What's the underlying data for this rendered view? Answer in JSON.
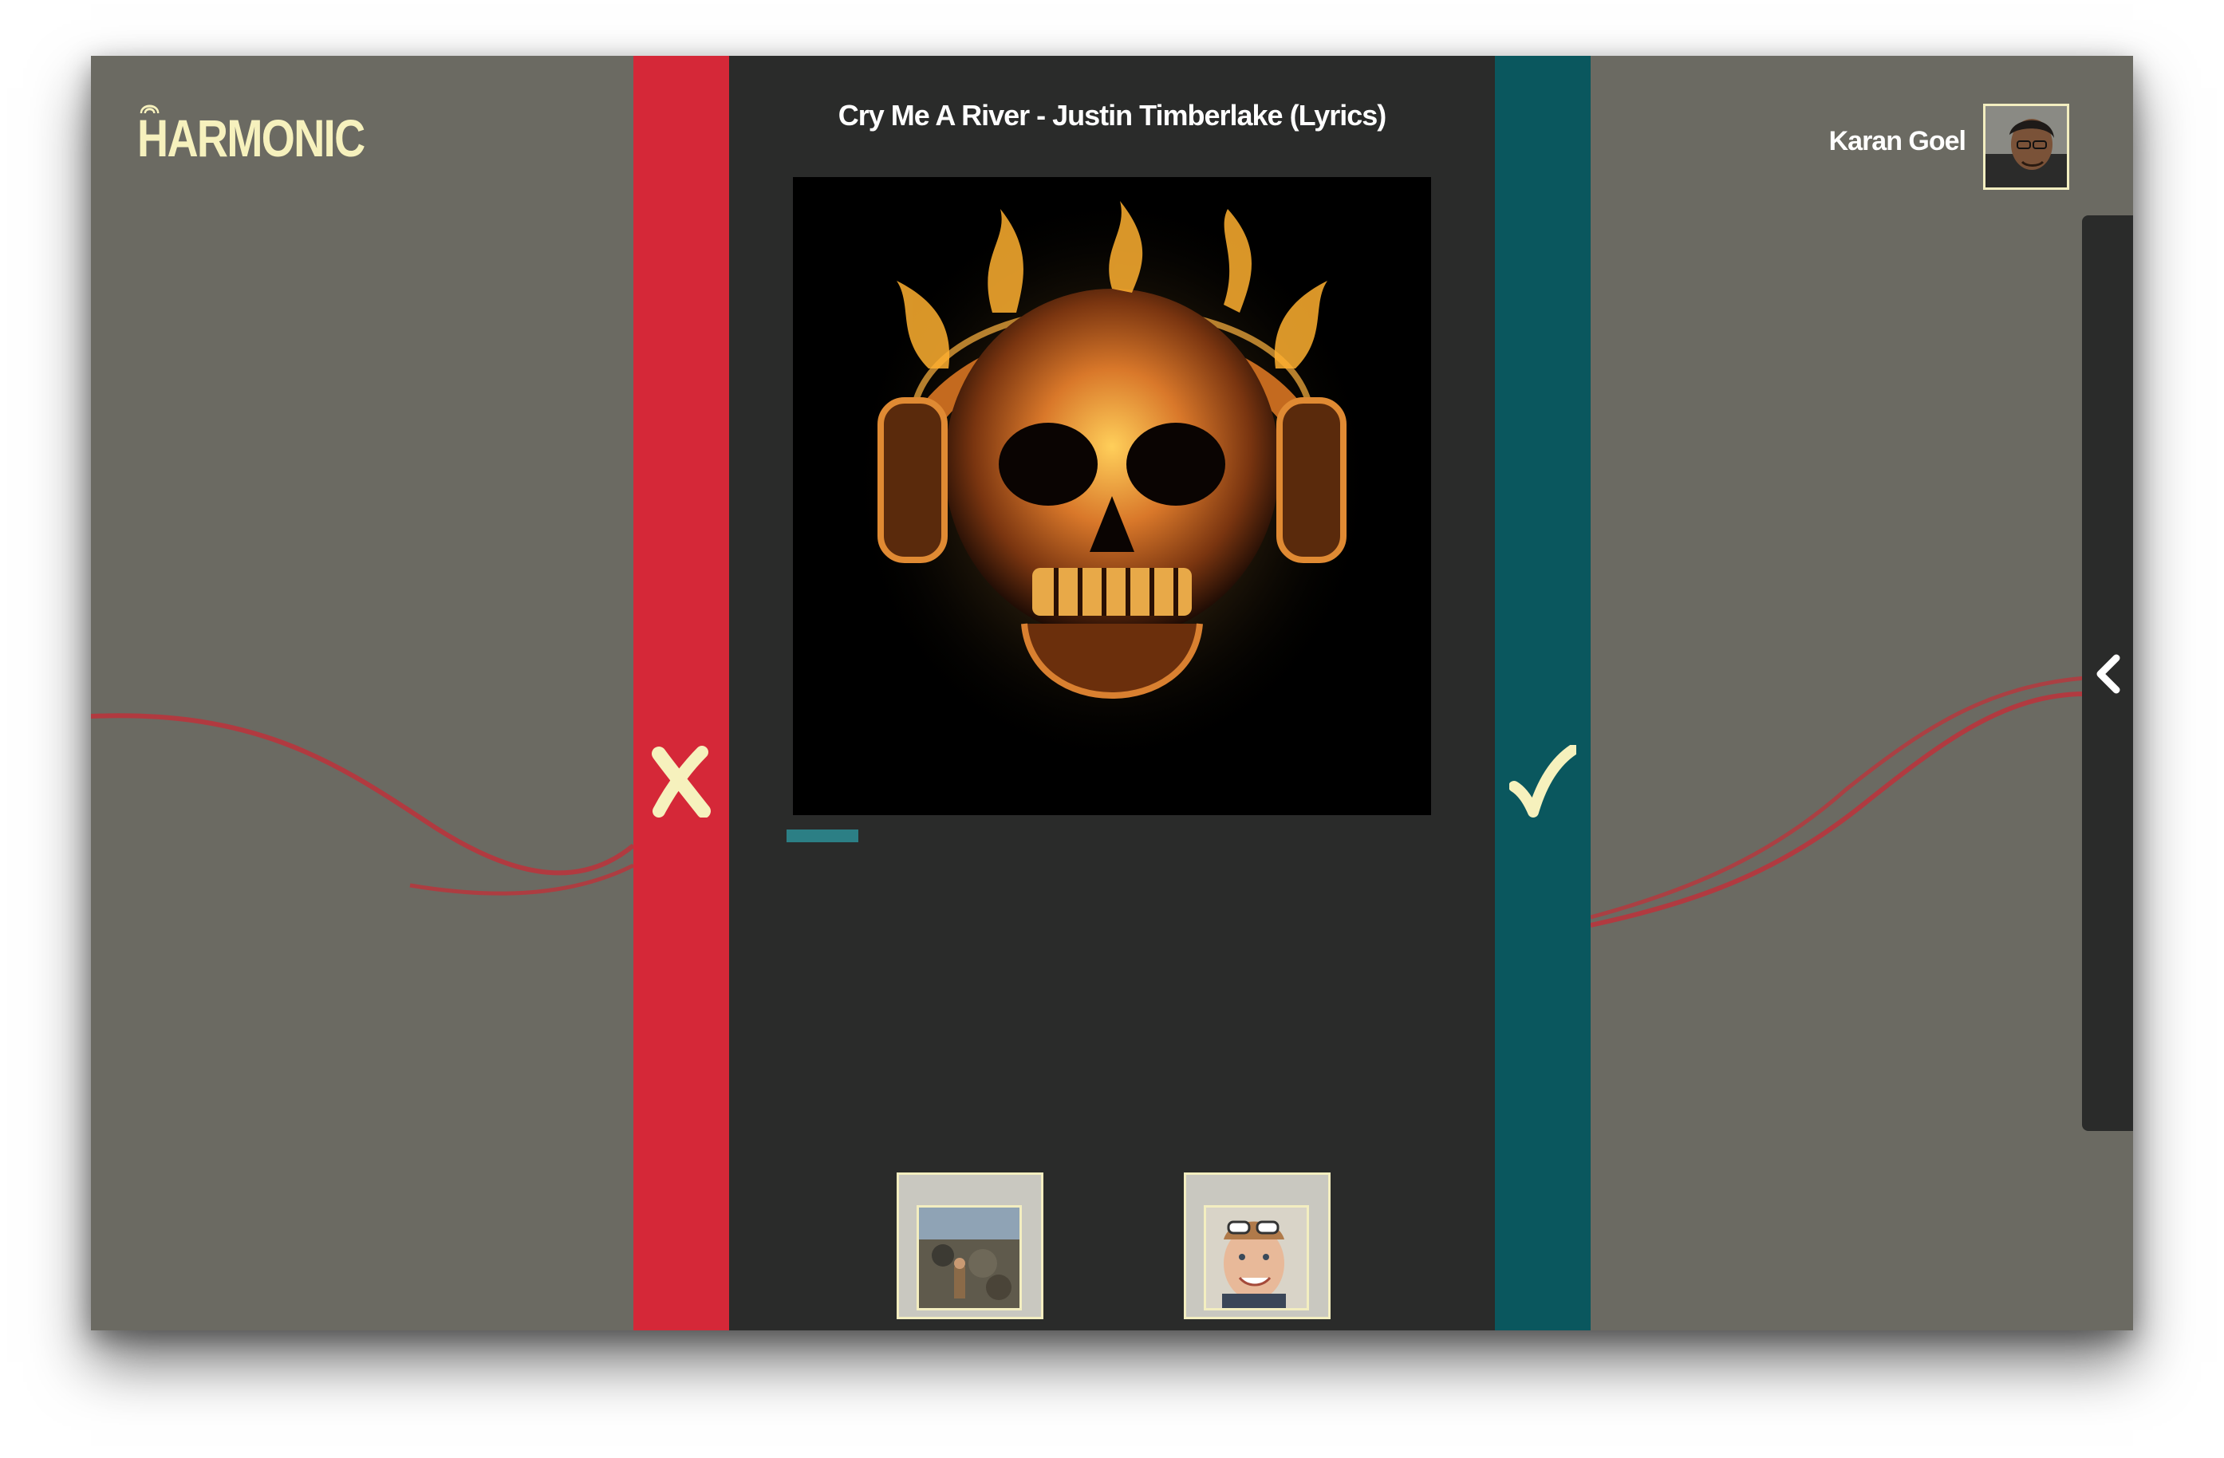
{
  "app": {
    "name": "HARMONIC",
    "colors": {
      "background": "#6b6a62",
      "panel": "#2a2b2a",
      "reject": "#d52838",
      "accept": "#0a575e",
      "accent_cream": "#f6f1bd",
      "progress": "#2c7f85",
      "wave": "#b5383e"
    }
  },
  "player": {
    "title": "Cry Me A River - Justin Timberlake (Lyrics)",
    "cover_icon": "flaming-skull-headphones-artwork",
    "progress": 0.11
  },
  "actions": {
    "reject_icon": "x-icon",
    "accept_icon": "checkmark-icon"
  },
  "user": {
    "name": "Karan Goel",
    "avatar_icon": "user-avatar"
  },
  "listeners": [
    {
      "icon": "listener-avatar-beach"
    },
    {
      "icon": "listener-avatar-sunglasses"
    }
  ],
  "drawer": {
    "toggle_icon": "chevron-left-icon"
  }
}
